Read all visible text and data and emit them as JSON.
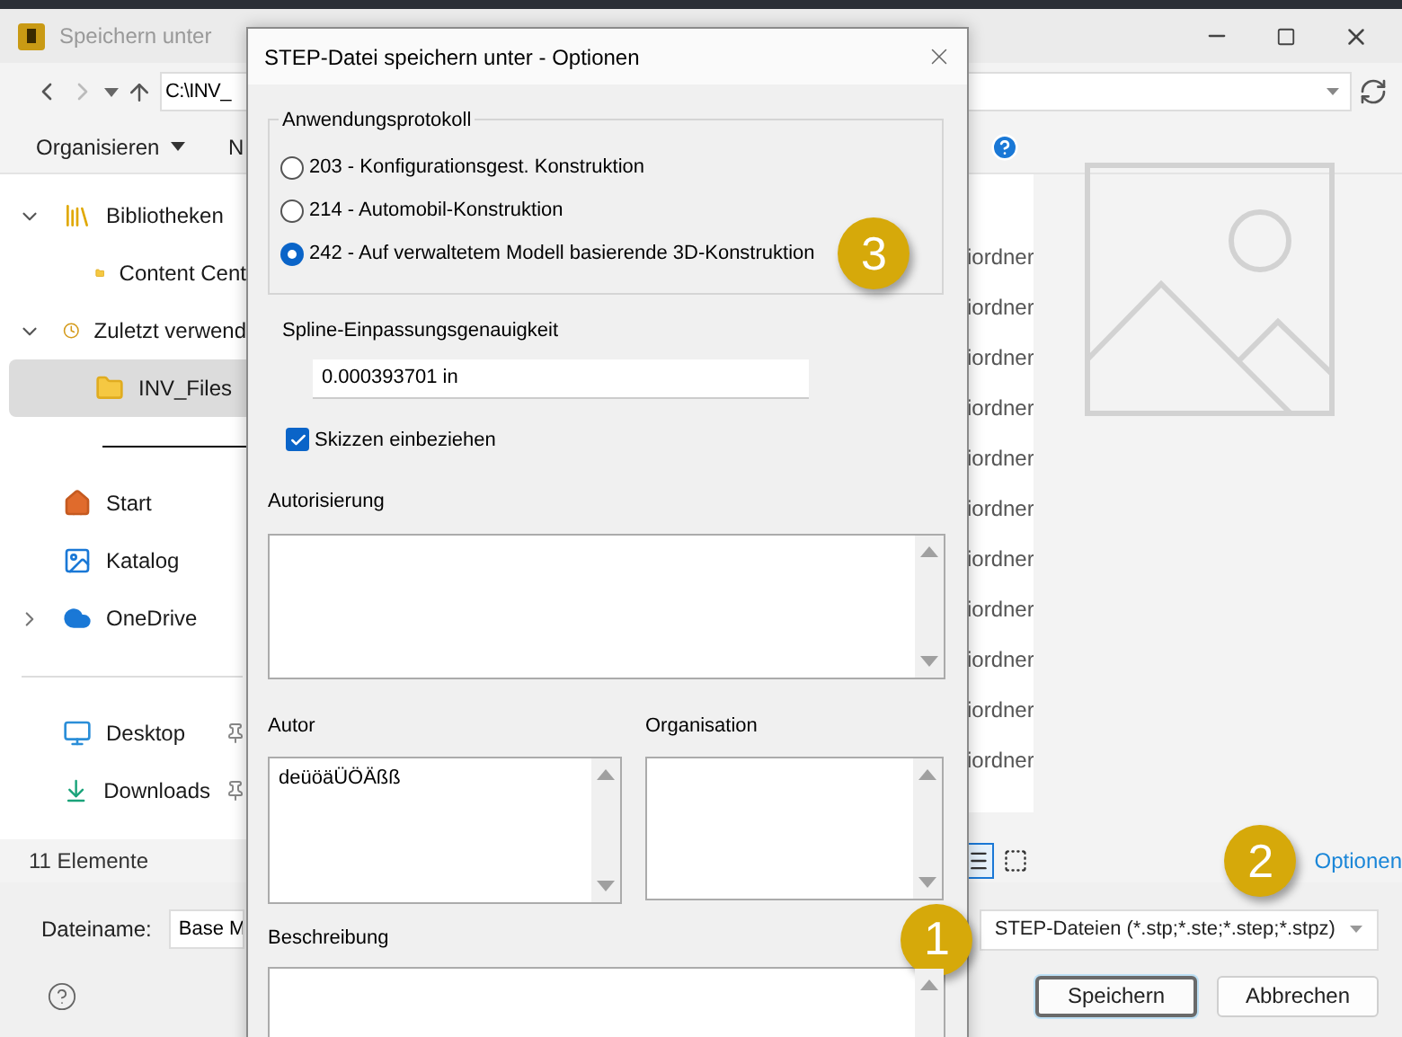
{
  "window": {
    "title": "Speichern unter"
  },
  "address": {
    "path": "C:\\INV_"
  },
  "toolbar": {
    "organize": "Organisieren",
    "new_folder": "N"
  },
  "nav": {
    "libraries": [
      {
        "label": "Bibliotheken",
        "kind": "library",
        "expanded": true,
        "selected": false,
        "children": [
          {
            "label": "Content Cent",
            "kind": "folder",
            "selected": false
          }
        ]
      },
      {
        "label": "Zuletzt verwend",
        "kind": "recent",
        "expanded": true,
        "selected": false,
        "children": [
          {
            "label": "INV_Files",
            "kind": "folder",
            "selected": true
          }
        ]
      }
    ],
    "locations": [
      {
        "label": "Start",
        "kind": "home",
        "selected": false
      },
      {
        "label": "Katalog",
        "kind": "gallery",
        "selected": false
      },
      {
        "label": "OneDrive",
        "kind": "cloud",
        "expanded": false,
        "selected": false
      }
    ],
    "pinned": [
      {
        "label": "Desktop",
        "kind": "desktop",
        "selected": false
      },
      {
        "label": "Downloads",
        "kind": "download",
        "selected": false
      }
    ]
  },
  "file_list": {
    "rows": [
      "iordner",
      "iordner",
      "iordner",
      "iordner",
      "iordner",
      "iordner",
      "iordner",
      "iordner",
      "iordner",
      "iordner",
      "iordner"
    ]
  },
  "status_bar": {
    "count": "11 Elemente",
    "views": [
      {
        "kind": "details",
        "selected": true
      },
      {
        "kind": "tiles",
        "selected": false
      }
    ]
  },
  "options": {
    "label": "Optionen",
    "badge": "2"
  },
  "filename": {
    "label": "Dateiname:",
    "value": "Base M"
  },
  "filetype": {
    "value": "STEP-Dateien (*.stp;*.ste;*.step;*.stpz)",
    "badge": "1"
  },
  "buttons": [
    {
      "label": "Speichern",
      "default": true
    },
    {
      "label": "Abbrechen",
      "default": false
    }
  ],
  "dialog": {
    "title": "STEP-Datei speichern unter - Optionen",
    "protocol": {
      "legend": "Anwendungsprotokoll",
      "badge": "3",
      "options": [
        {
          "label": "203 - Konfigurationsgest. Konstruktion",
          "selected": false
        },
        {
          "label": "214 - Automobil-Konstruktion",
          "selected": false
        },
        {
          "label": "242 - Auf verwaltetem Modell basierende 3D-Konstruktion",
          "selected": true
        }
      ]
    },
    "spline": {
      "label": "Spline-Einpassungsgenauigkeit",
      "value": "0.000393701 in"
    },
    "sketches": {
      "label": "Skizzen einbeziehen",
      "checked": true
    },
    "authorization": {
      "label": "Autorisierung"
    },
    "author": {
      "label": "Autor",
      "value": "deüöäÜÖÄßß"
    },
    "organization": {
      "label": "Organisation"
    },
    "description": {
      "label": "Beschreibung"
    }
  }
}
